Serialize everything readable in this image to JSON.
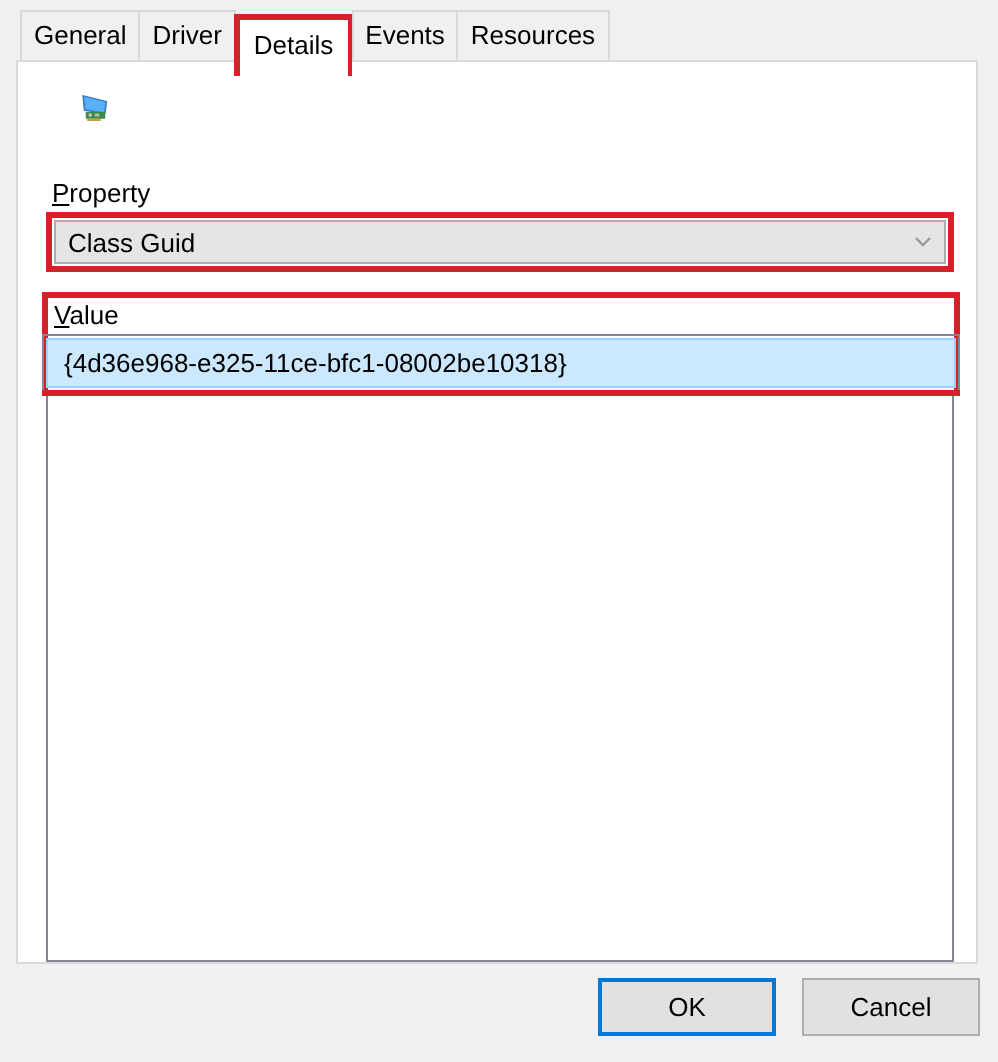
{
  "tabs": [
    {
      "label": "General",
      "selected": false,
      "highlighted": false
    },
    {
      "label": "Driver",
      "selected": false,
      "highlighted": false
    },
    {
      "label": "Details",
      "selected": true,
      "highlighted": true
    },
    {
      "label": "Events",
      "selected": false,
      "highlighted": false
    },
    {
      "label": "Resources",
      "selected": false,
      "highlighted": false
    }
  ],
  "property": {
    "label": "Property",
    "value": "Class Guid",
    "highlighted": true
  },
  "value": {
    "label": "Value",
    "highlighted": true,
    "items": [
      {
        "text": "{4d36e968-e325-11ce-bfc1-08002be10318}",
        "selected": true
      }
    ]
  },
  "buttons": [
    {
      "label": "OK",
      "kind": "default"
    },
    {
      "label": "Cancel",
      "kind": "normal"
    }
  ]
}
